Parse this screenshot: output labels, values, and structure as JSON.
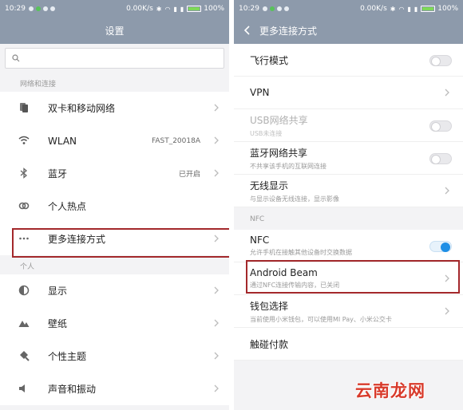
{
  "left": {
    "status": {
      "time": "10:29",
      "speed": "0.00K/s",
      "battery": "100%"
    },
    "title": "设置",
    "search": {
      "placeholder": ""
    },
    "section1": "网络和连接",
    "network_items": [
      {
        "label": "双卡和移动网络",
        "value": "",
        "icon": "sim-card-icon"
      },
      {
        "label": "WLAN",
        "value": "FAST_20018A",
        "icon": "wifi-icon"
      },
      {
        "label": "蓝牙",
        "value": "已开启",
        "icon": "bluetooth-icon"
      },
      {
        "label": "个人热点",
        "value": "",
        "icon": "hotspot-icon"
      },
      {
        "label": "更多连接方式",
        "value": "",
        "icon": "more-dots-icon"
      }
    ],
    "section2": "个人",
    "personal_items": [
      {
        "label": "显示",
        "icon": "display-icon"
      },
      {
        "label": "壁纸",
        "icon": "wallpaper-icon"
      },
      {
        "label": "个性主题",
        "icon": "theme-brush-icon"
      },
      {
        "label": "声音和振动",
        "icon": "speaker-icon"
      }
    ]
  },
  "right": {
    "status": {
      "time": "10:29",
      "speed": "0.00K/s",
      "battery": "100%"
    },
    "title": "更多连接方式",
    "items": [
      {
        "label": "飞行模式",
        "sub": "",
        "control": "toggle",
        "on": false
      },
      {
        "label": "VPN",
        "sub": "",
        "control": "chevron"
      },
      {
        "label": "USB网络共享",
        "sub": "USB未连接",
        "control": "toggle",
        "on": false,
        "disabled": true
      },
      {
        "label": "蓝牙网络共享",
        "sub": "不共享该手机的互联网连接",
        "control": "toggle",
        "on": false
      },
      {
        "label": "无线显示",
        "sub": "与显示设备无线连接，显示影像",
        "control": "chevron"
      }
    ],
    "nfc_section": "NFC",
    "nfc_items": [
      {
        "label": "NFC",
        "sub": "允许手机在接触其他设备时交换数据",
        "control": "toggle",
        "on": true
      },
      {
        "label": "Android Beam",
        "sub": "通过NFC连接传输内容，已关闭",
        "control": "chevron"
      },
      {
        "label": "钱包选择",
        "sub": "当前使用小米钱包，可以使用MI Pay、小米公交卡",
        "control": "chevron"
      },
      {
        "label": "触碰付款",
        "sub": "",
        "control": "none"
      }
    ]
  },
  "watermark": "云南龙网",
  "colors": {
    "header": "#8d9aab",
    "highlight": "#a3282b",
    "toggle_on": "#1e8fe6",
    "watermark": "#d83a2b"
  }
}
